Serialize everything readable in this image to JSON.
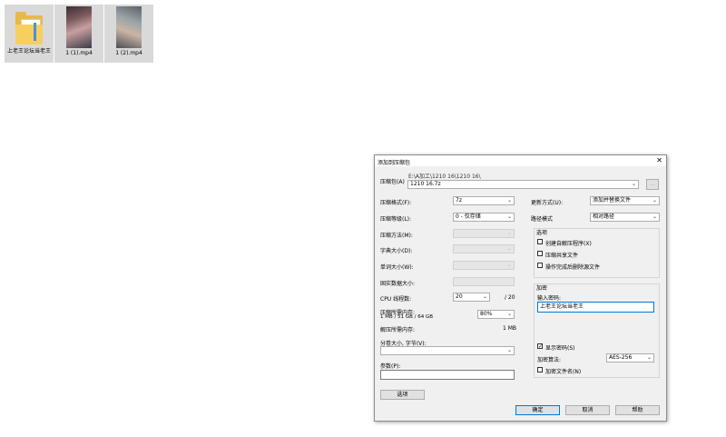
{
  "desktop": {
    "icons": [
      {
        "label": "上老王论坛当老王"
      },
      {
        "label": "1 (1).mp4"
      },
      {
        "label": "1 (2).mp4"
      }
    ]
  },
  "dialog": {
    "title": "添加到压缩包",
    "close_glyph": "✕",
    "archive_label": "压缩包(A)",
    "archive_path": "E:\\A加工\\1210 16\\1210 16\\",
    "archive_name": "1210 16.7z",
    "browse_label": "...",
    "format_label": "压缩格式(F):",
    "format_value": "7z",
    "level_label": "压缩等级(L):",
    "level_value": "0 - 仅存储",
    "method_label": "压缩方法(M):",
    "dict_label": "字典大小(D):",
    "word_label": "单词大小(W):",
    "solid_label": "固实数据大小:",
    "threads_label": "CPU 线程数:",
    "threads_value": "20",
    "threads_max": "/ 20",
    "mem_label": "压缩所需内存:",
    "mem_info": "1 MB / 51 GB / 64 GB",
    "mem_value": "80%",
    "decomp_mem_label": "解压所需内存:",
    "decomp_mem_value": "1 MB",
    "split_label": "分卷大小, 字节(V):",
    "params_label": "参数(P):",
    "options_button": "选项",
    "update_label": "更新方式(U):",
    "update_value": "添加并替换文件",
    "pathmode_label": "路径模式",
    "pathmode_value": "相对路径",
    "options_group": "选项",
    "opt_sfx": "创建自解压程序(X)",
    "opt_shared": "压缩共享文件",
    "opt_delete": "操作完成后删除源文件",
    "encrypt_group": "加密",
    "password_label": "输入密码:",
    "password_value": "上老王论坛当老王",
    "show_password": "显示密码(S)",
    "show_password_checked": "✓",
    "enc_method_label": "加密算法:",
    "enc_method_value": "AES-256",
    "encrypt_names": "加密文件名(N)",
    "ok": "确定",
    "cancel": "取消",
    "help": "帮助"
  }
}
